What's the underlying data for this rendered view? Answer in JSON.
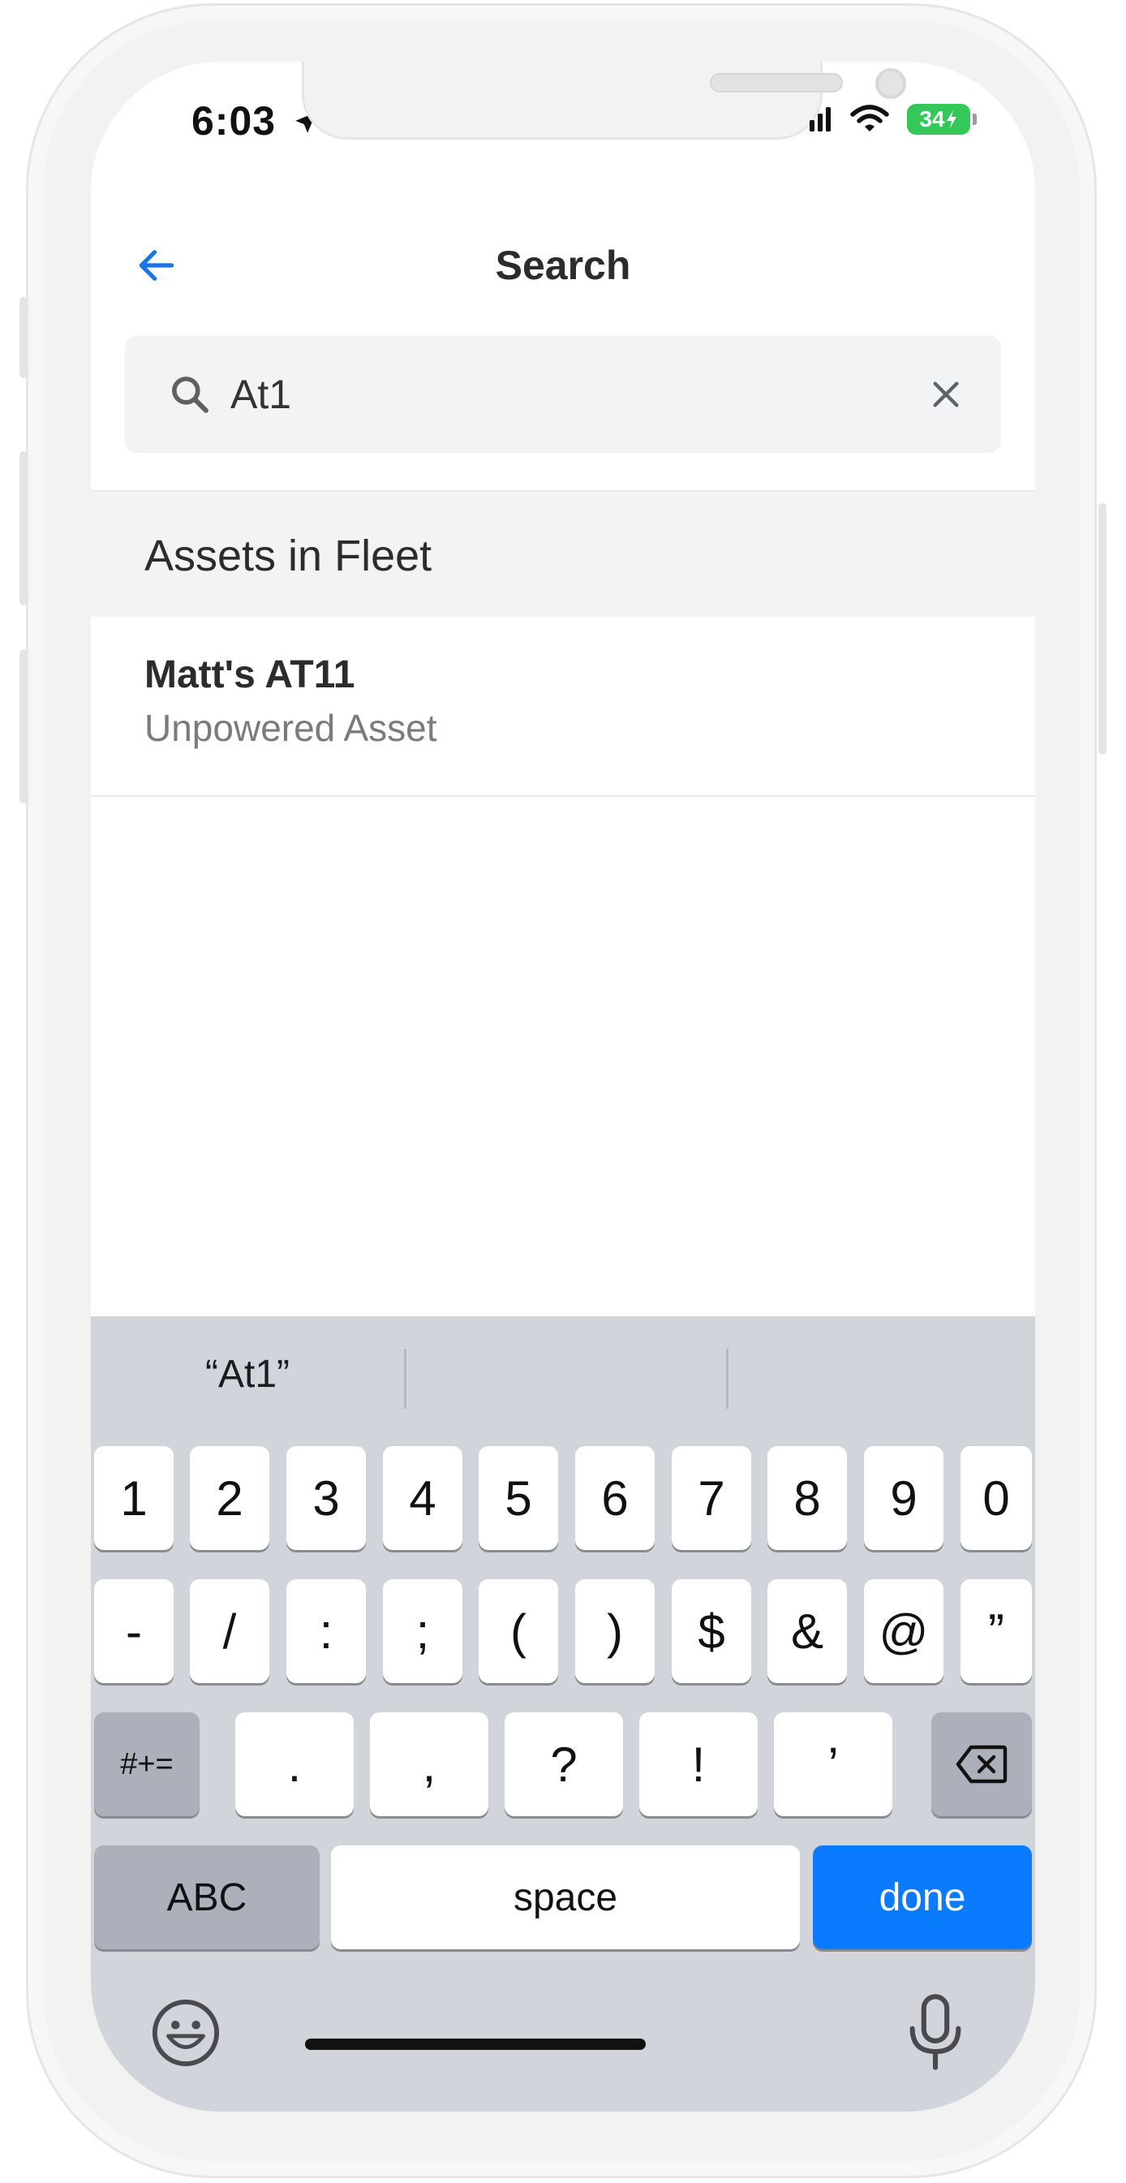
{
  "status_bar": {
    "time": "6:03",
    "battery": "34"
  },
  "header": {
    "title": "Search"
  },
  "search": {
    "value": "At1",
    "placeholder": ""
  },
  "sections": [
    {
      "title": "Assets in Fleet",
      "items": [
        {
          "name": "Matt's AT11",
          "subtitle": "Unpowered Asset"
        }
      ]
    }
  ],
  "keyboard": {
    "suggestions": [
      "“At1”",
      "",
      ""
    ],
    "row1": [
      "1",
      "2",
      "3",
      "4",
      "5",
      "6",
      "7",
      "8",
      "9",
      "0"
    ],
    "row2": [
      "-",
      "/",
      ":",
      ";",
      "(",
      ")",
      "$",
      "&",
      "@",
      "”"
    ],
    "row3_mode": "#+=",
    "row3": [
      ".",
      ",",
      "?",
      "!",
      "’"
    ],
    "abc": "ABC",
    "space": "space",
    "done": "done"
  },
  "colors": {
    "accent": "#1a73e8",
    "done_key": "#0a7aff",
    "battery": "#34c759"
  },
  "icons": [
    "location-arrow-icon",
    "signal-icon",
    "wifi-icon",
    "battery-icon",
    "back-arrow-icon",
    "search-icon",
    "clear-icon",
    "backspace-icon",
    "emoji-icon",
    "microphone-icon"
  ]
}
